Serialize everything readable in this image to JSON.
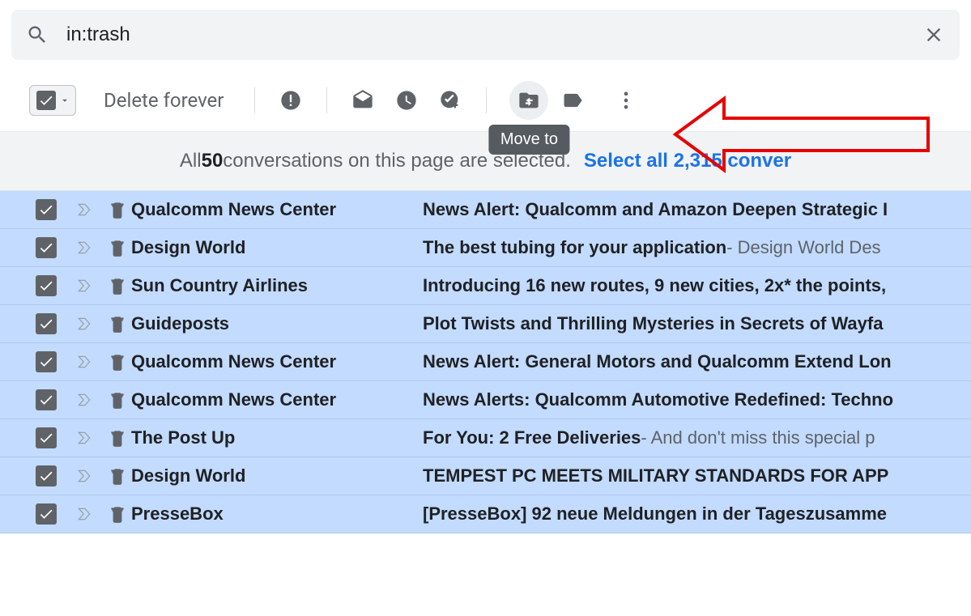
{
  "search": {
    "value": "in:trash"
  },
  "toolbar": {
    "delete_forever": "Delete forever",
    "tooltip_move_to": "Move to"
  },
  "banner": {
    "prefix": "All ",
    "count": "50",
    "suffix": " conversations on this page are selected.",
    "link": "Select all 2,315 conver"
  },
  "rows": [
    {
      "sender": "Qualcomm News Center",
      "subject": "News Alert: Qualcomm and Amazon Deepen Strategic I",
      "preview": ""
    },
    {
      "sender": "Design World",
      "subject": "The best tubing for your application",
      "preview": " - Design World Des"
    },
    {
      "sender": "Sun Country Airlines",
      "subject": "Introducing 16 new routes, 9 new cities, 2x* the points,",
      "preview": ""
    },
    {
      "sender": "Guideposts",
      "subject": "Plot Twists and Thrilling Mysteries in Secrets of Wayfa",
      "preview": ""
    },
    {
      "sender": "Qualcomm News Center",
      "subject": "News Alert: General Motors and Qualcomm Extend Lon",
      "preview": ""
    },
    {
      "sender": "Qualcomm News Center",
      "subject": "News Alerts: Qualcomm Automotive Redefined: Techno",
      "preview": ""
    },
    {
      "sender": "The Post Up",
      "subject": "For You: 2 Free Deliveries",
      "preview": " - And don't miss this special p"
    },
    {
      "sender": "Design World",
      "subject": "TEMPEST PC MEETS MILITARY STANDARDS FOR APP",
      "preview": ""
    },
    {
      "sender": "PresseBox",
      "subject": "[PresseBox] 92 neue Meldungen in der Tageszusamme",
      "preview": ""
    }
  ]
}
